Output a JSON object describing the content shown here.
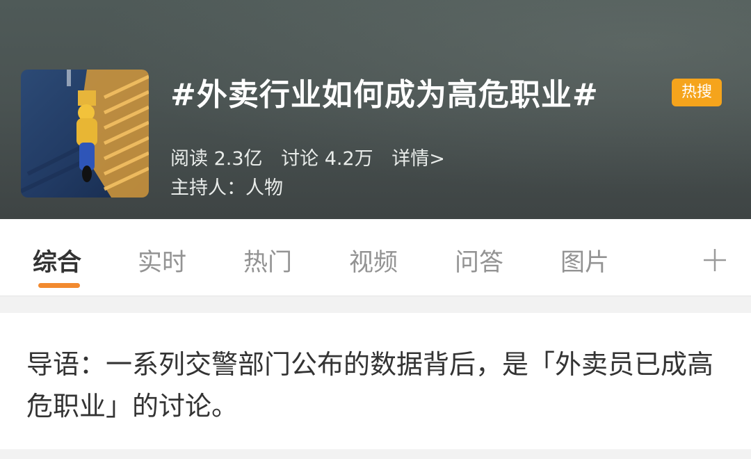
{
  "topic": {
    "title": "#外卖行业如何成为高危职业#",
    "badge": "热搜",
    "reads": "阅读 2.3亿",
    "discussions": "讨论 4.2万",
    "details": "详情>",
    "host": "主持人：人物"
  },
  "tabs": [
    {
      "label": "综合"
    },
    {
      "label": "实时"
    },
    {
      "label": "热门"
    },
    {
      "label": "视频"
    },
    {
      "label": "问答"
    },
    {
      "label": "图片"
    }
  ],
  "intro": {
    "text": "导语：一系列交警部门公布的数据背后，是「外卖员已成高危职业」的讨论。"
  },
  "colors": {
    "accent": "#f28a2f",
    "badge": "#f5a41c"
  },
  "icons": {
    "add_tab": "plus-icon"
  }
}
